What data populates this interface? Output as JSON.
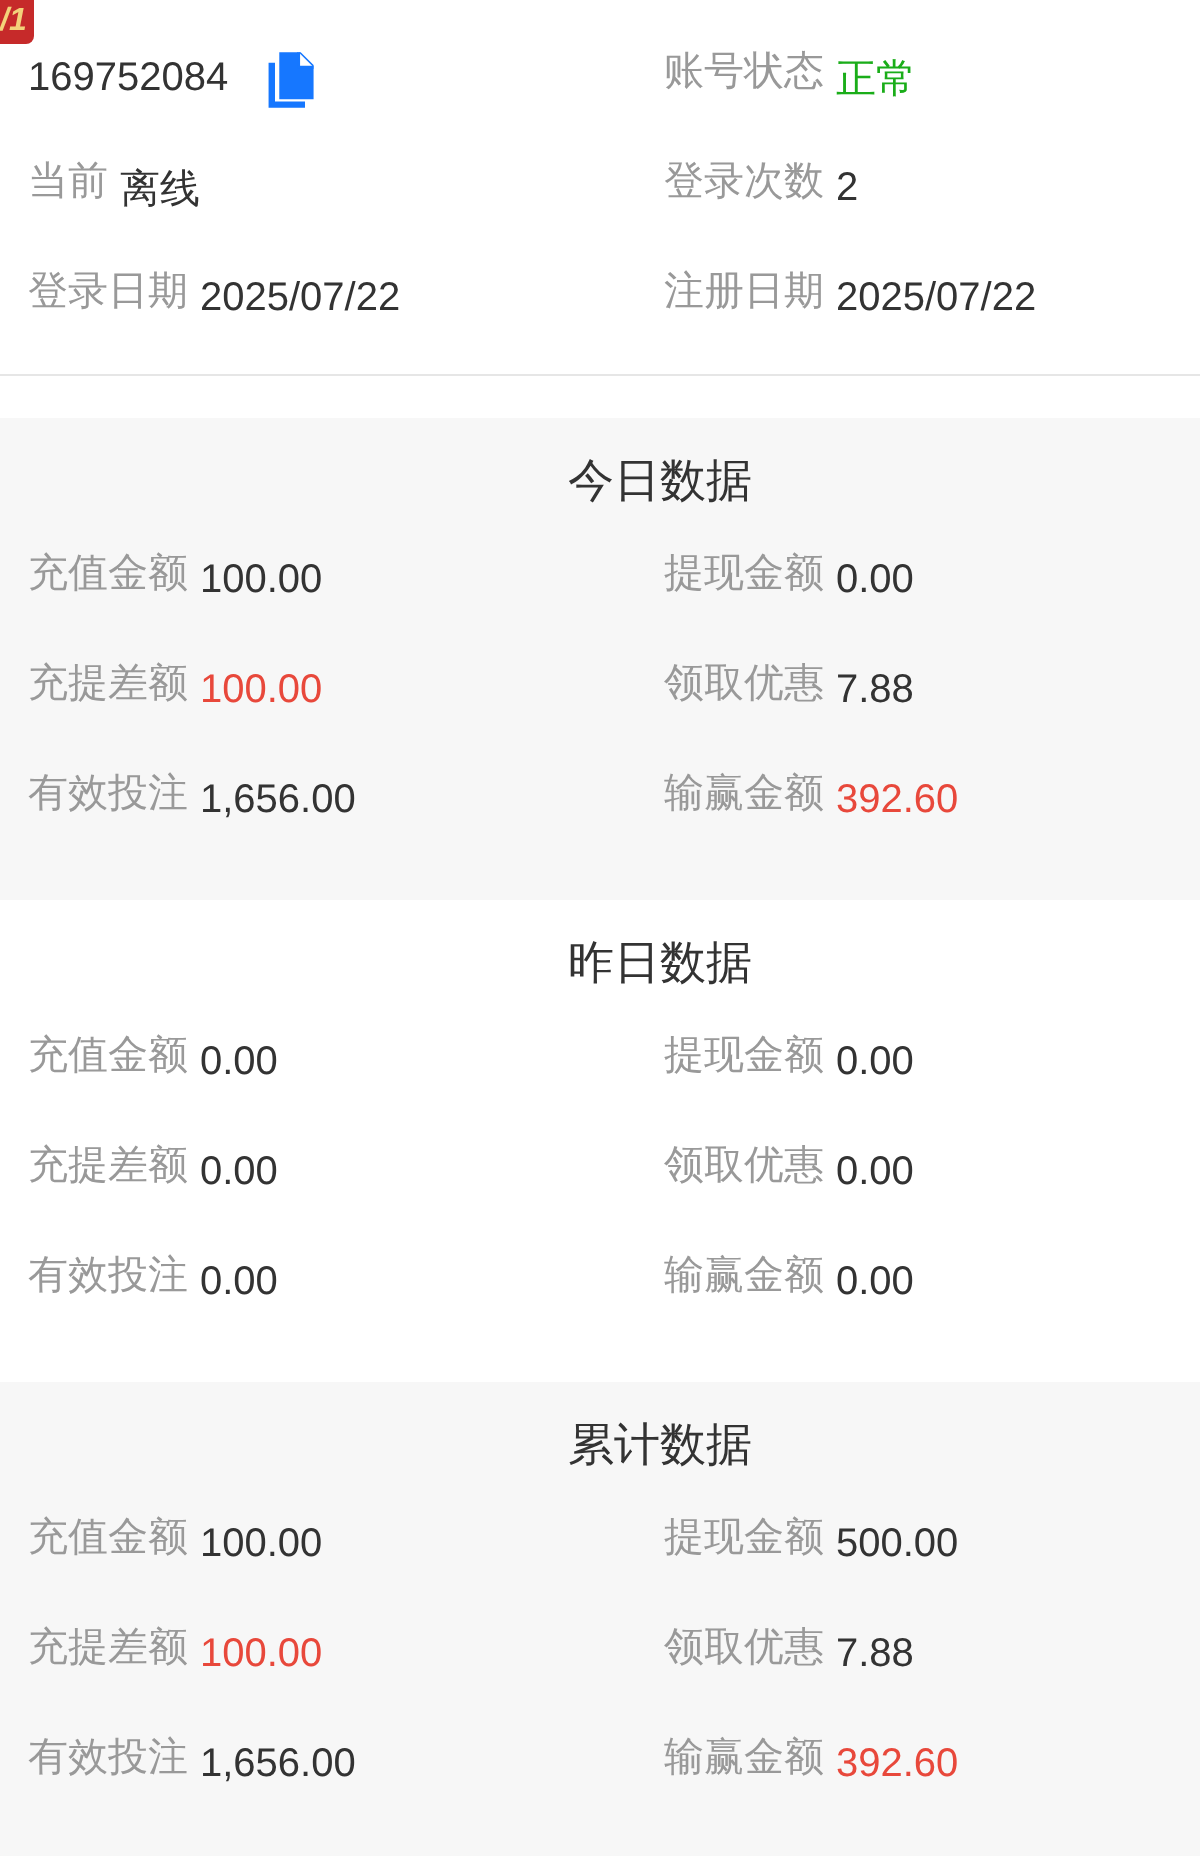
{
  "badge": "/1",
  "account": {
    "id": "169752084"
  },
  "info": [
    {
      "label": "账号状态",
      "value": "正常",
      "color": "#1aad19"
    },
    {
      "label": "当前",
      "value": "离线"
    },
    {
      "label": "登录次数",
      "value": "2"
    },
    {
      "label": "登录日期",
      "value": "2025/07/22"
    },
    {
      "label": "注册日期",
      "value": "2025/07/22"
    }
  ],
  "sections": [
    {
      "title": "今日数据",
      "items": [
        {
          "label": "充值金额",
          "value": "100.00"
        },
        {
          "label": "提现金额",
          "value": "0.00"
        },
        {
          "label": "充提差额",
          "value": "100.00",
          "color": "#e8483b"
        },
        {
          "label": "领取优惠",
          "value": "7.88"
        },
        {
          "label": "有效投注",
          "value": "1,656.00"
        },
        {
          "label": "输赢金额",
          "value": "392.60",
          "color": "#e8483b"
        }
      ]
    },
    {
      "title": "昨日数据",
      "items": [
        {
          "label": "充值金额",
          "value": "0.00"
        },
        {
          "label": "提现金额",
          "value": "0.00"
        },
        {
          "label": "充提差额",
          "value": "0.00"
        },
        {
          "label": "领取优惠",
          "value": "0.00"
        },
        {
          "label": "有效投注",
          "value": "0.00"
        },
        {
          "label": "输赢金额",
          "value": "0.00"
        }
      ]
    },
    {
      "title": "累计数据",
      "items": [
        {
          "label": "充值金额",
          "value": "100.00"
        },
        {
          "label": "提现金额",
          "value": "500.00"
        },
        {
          "label": "充提差额",
          "value": "100.00",
          "color": "#e8483b"
        },
        {
          "label": "领取优惠",
          "value": "7.88"
        },
        {
          "label": "有效投注",
          "value": "1,656.00"
        },
        {
          "label": "输赢金额",
          "value": "392.60",
          "color": "#e8483b"
        }
      ]
    }
  ]
}
